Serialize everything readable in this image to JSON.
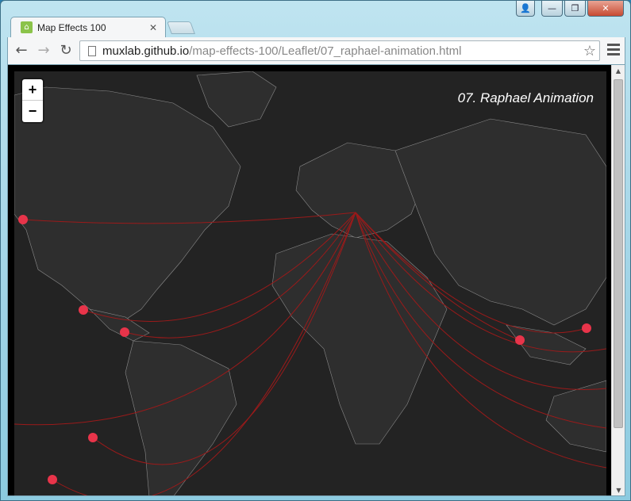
{
  "window": {
    "controls": {
      "user": "👤",
      "minimize": "—",
      "maximize": "❐",
      "close": "✕"
    }
  },
  "tab": {
    "title": "Map Effects 100",
    "close": "✕",
    "favicon": "map-favicon"
  },
  "toolbar": {
    "back": "←",
    "forward": "→",
    "reload": "↻",
    "url_host": "muxlab.github.io",
    "url_path": "/map-effects-100/Leaflet/07_raphael-animation.html",
    "star": "☆"
  },
  "map": {
    "zoom_in": "+",
    "zoom_out": "−",
    "title": "07. Raphael Animation",
    "colors": {
      "background": "#232323",
      "land": "#2f2f2f",
      "borders": "#7a7a7a",
      "arcs": "#9b1a1a",
      "markers": "#e8344a"
    }
  },
  "scrollbar": {
    "up": "▲",
    "down": "▼"
  }
}
